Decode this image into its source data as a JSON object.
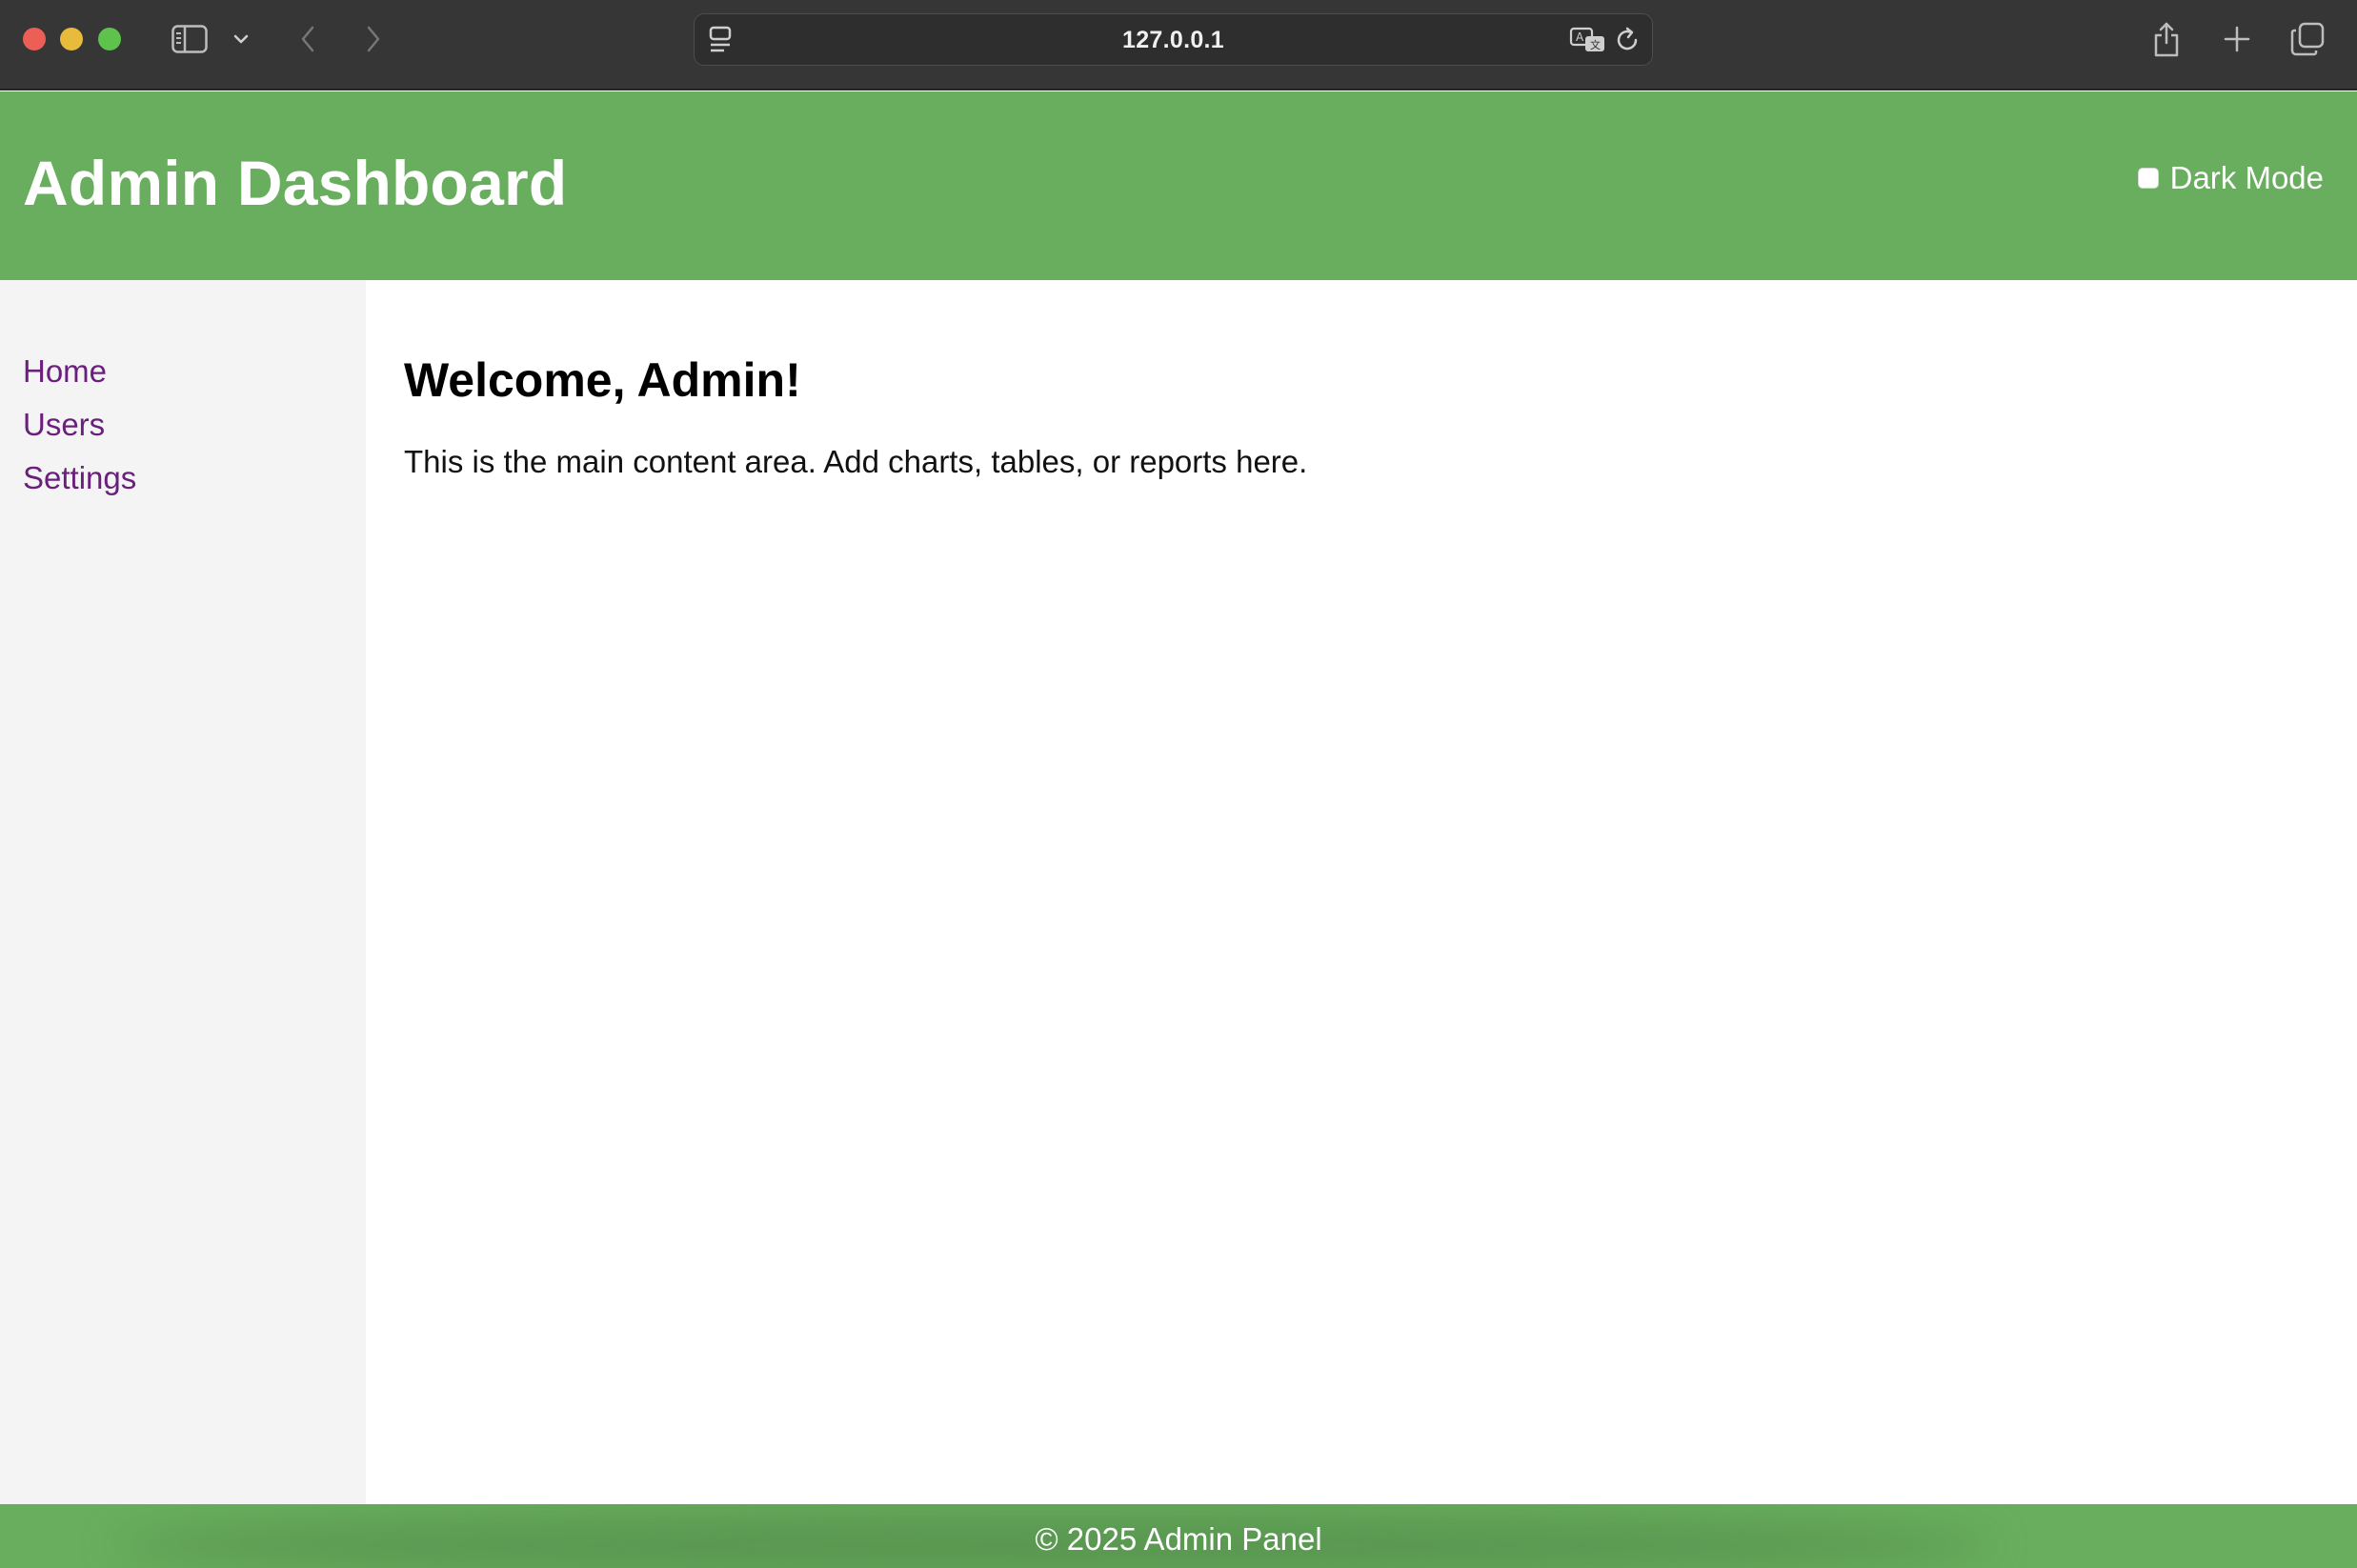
{
  "browser": {
    "url": "127.0.0.1",
    "icons": {
      "sidebar_toggle": "sidebar-icon",
      "chevron": "chevron-down-icon",
      "back": "chevron-left-icon",
      "forward": "chevron-right-icon",
      "reader": "reader-icon",
      "translate": "translate-icon",
      "reload": "reload-icon",
      "share": "share-icon",
      "new_tab": "plus-icon",
      "tabs": "tabs-overview-icon"
    }
  },
  "header": {
    "title": "Admin Dashboard",
    "dark_mode_label": "Dark Mode",
    "dark_mode_checked": false
  },
  "sidebar": {
    "items": [
      {
        "label": "Home"
      },
      {
        "label": "Users"
      },
      {
        "label": "Settings"
      }
    ]
  },
  "main": {
    "heading": "Welcome, Admin!",
    "text": "This is the main content area. Add charts, tables, or reports here."
  },
  "footer": {
    "text": "© 2025 Admin Panel"
  },
  "colors": {
    "brand_green": "#69ae5e",
    "link_purple": "#6b1f7c",
    "sidebar_bg": "#f4f4f4",
    "chrome_bg": "#363636"
  }
}
